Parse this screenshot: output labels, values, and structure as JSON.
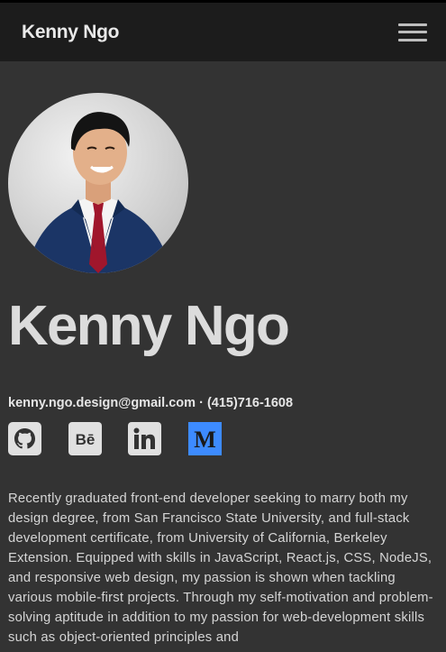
{
  "navbar": {
    "brand": "Kenny Ngo",
    "menu_icon": "hamburger-menu-icon"
  },
  "profile": {
    "avatar_icon": "profile-photo",
    "name": "Kenny Ngo",
    "email": "kenny.ngo.design@gmail.com",
    "separator": "·",
    "phone": "(415)716-1608"
  },
  "socials": [
    {
      "icon": "github-icon",
      "color": "#e0e0e0"
    },
    {
      "icon": "behance-icon",
      "color": "#e0e0e0"
    },
    {
      "icon": "linkedin-icon",
      "color": "#e0e0e0"
    },
    {
      "icon": "medium-icon",
      "color": "#3d8bff"
    }
  ],
  "bio": "Recently graduated front-end developer seeking to marry both my design degree, from San Francisco State University, and full-stack development certificate, from University of California, Berkeley Extension. Equipped with skills in JavaScript, React.js, CSS, NodeJS, and responsive web design, my passion is shown when tackling various mobile-first projects. Through my self-motivation and problem-solving aptitude in addition to my passion for web-development skills such as object-oriented principles and",
  "colors": {
    "background": "#333333",
    "navbar": "#1c1c1c",
    "accent": "#3d8bff"
  }
}
